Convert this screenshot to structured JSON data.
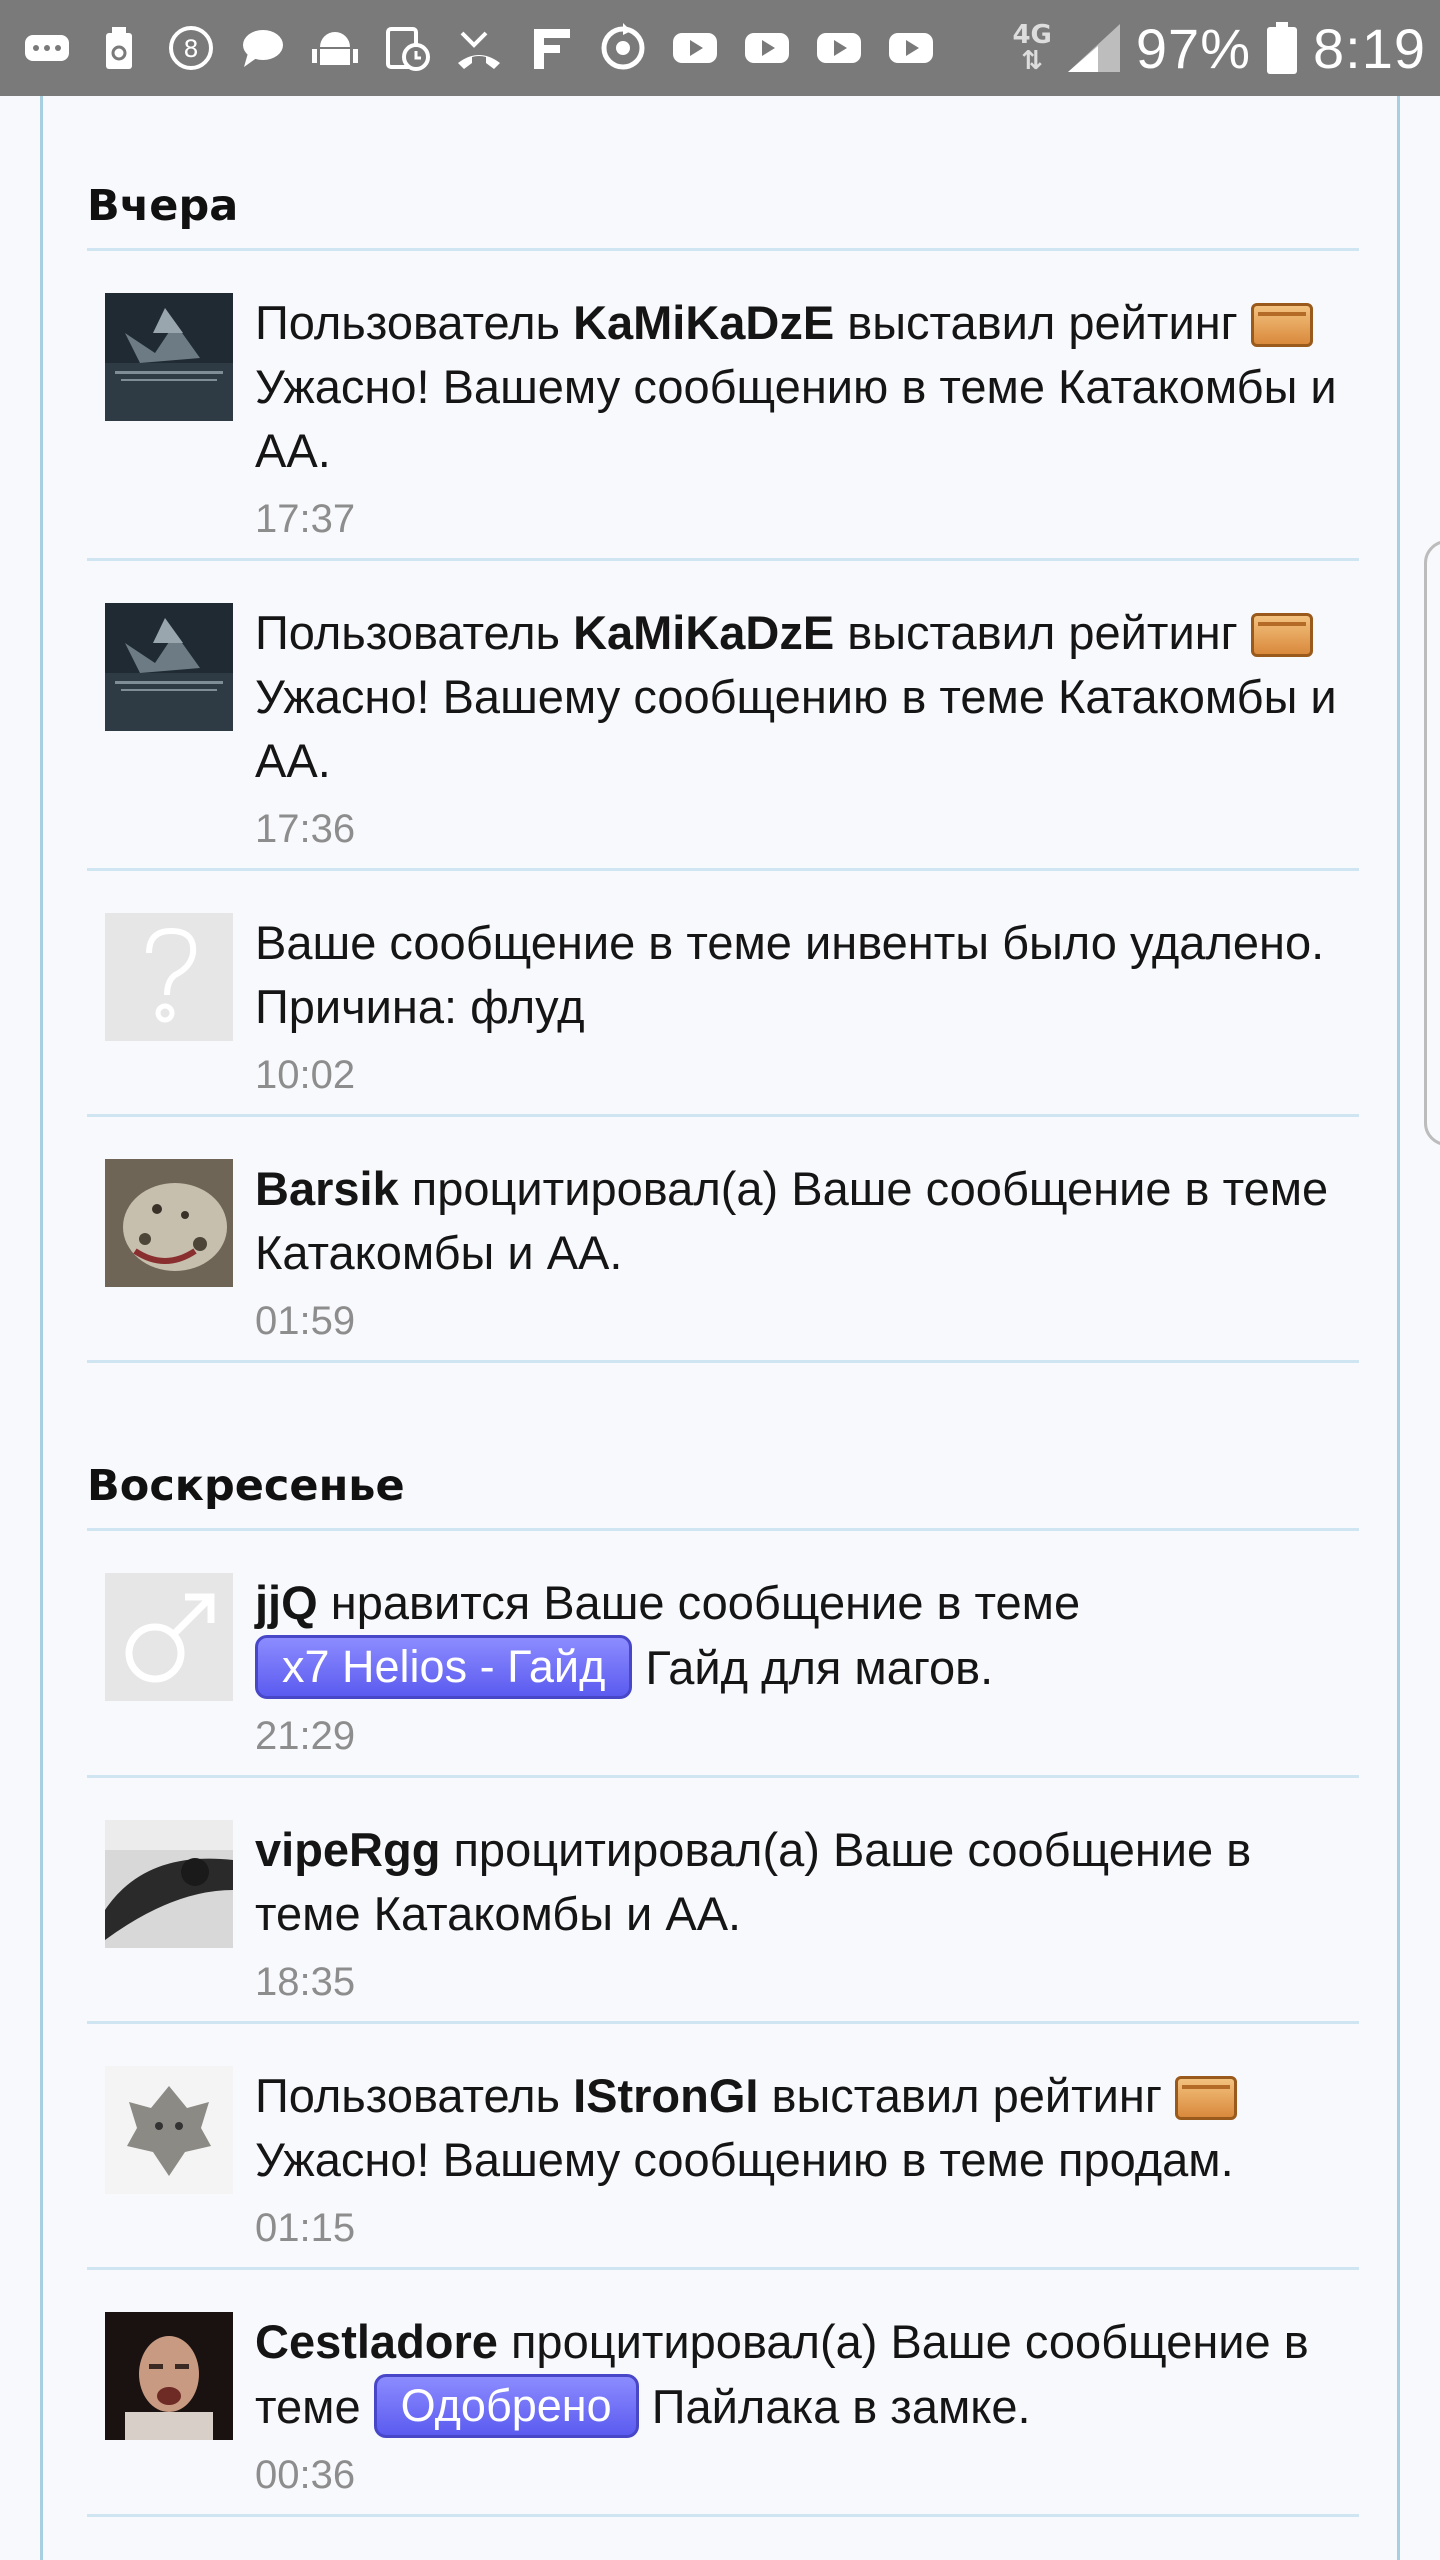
{
  "status_bar": {
    "network": "4G",
    "battery": "97%",
    "time": "8:19",
    "left_icons": [
      "more-icon",
      "trash-icon",
      "badge-8-icon",
      "chat-icon",
      "android-icon",
      "tablet-clock-icon",
      "missed-call-icon",
      "f-icon",
      "sync-icon",
      "youtube-icon",
      "youtube-icon",
      "youtube-icon",
      "youtube-icon"
    ]
  },
  "sections": [
    {
      "title": "Вчера",
      "items": [
        {
          "avatar": "dark-landscape",
          "pre": "Пользователь ",
          "user": "KaMiKaDzE",
          "mid": " выставил рейтинг ",
          "icon": true,
          "post": " Ужасно! Вашему сообщению в теме Катакомбы и АА.",
          "time": "17:37"
        },
        {
          "avatar": "dark-landscape",
          "pre": "Пользователь ",
          "user": "KaMiKaDzE",
          "mid": " выставил рейтинг ",
          "icon": true,
          "post": " Ужасно! Вашему сообщению в теме Катакомбы и АА.",
          "time": "17:36"
        },
        {
          "avatar": "question",
          "pre": "Ваше сообщение в теме инвенты было удалено. Причина: флуд",
          "time": "10:02"
        },
        {
          "avatar": "leopard",
          "user": "Barsik",
          "mid": " процитировал(а) Ваше сообщение в теме Катакомбы и АА.",
          "time": "01:59"
        }
      ]
    },
    {
      "title": "Воскресенье",
      "items": [
        {
          "avatar": "male",
          "user": "jjQ",
          "mid": " нравится Ваше сообщение в теме ",
          "tag": "x7 Helios - Гайд",
          "post": " Гайд для магов.",
          "time": "21:29"
        },
        {
          "avatar": "cat",
          "user": "vipeRgg",
          "mid": " процитировал(а) Ваше сообщение в теме Катакомбы и АА.",
          "time": "18:35"
        },
        {
          "avatar": "wolf",
          "pre": "Пользователь ",
          "user": "IStronGI",
          "mid": " выставил рейтинг ",
          "icon": true,
          "post": " Ужасно! Вашему сообщению в теме продам.",
          "time": "01:15"
        },
        {
          "avatar": "face",
          "user": "Cestladore",
          "mid": " процитировал(а) Ваше сообщение в теме ",
          "tag": "Одобрено",
          "post": " Пайлака в замке.",
          "time": "00:36"
        }
      ]
    }
  ]
}
